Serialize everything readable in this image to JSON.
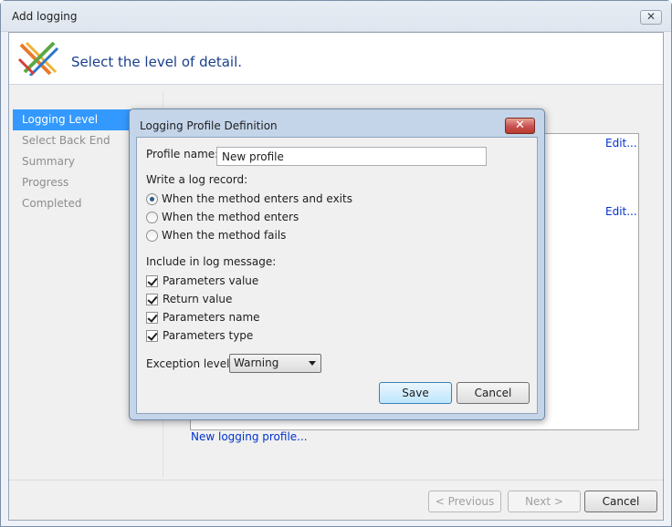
{
  "window": {
    "title": "Add logging"
  },
  "header": {
    "title": "Select the level of detail."
  },
  "nav": {
    "items": [
      {
        "label": "Logging Level",
        "active": true
      },
      {
        "label": "Select Back End",
        "active": false
      },
      {
        "label": "Summary",
        "active": false
      },
      {
        "label": "Progress",
        "active": false
      },
      {
        "label": "Completed",
        "active": false
      }
    ]
  },
  "panel": {
    "edit_links": [
      "Edit...",
      "Edit..."
    ],
    "new_profile_link": "New logging profile..."
  },
  "footer": {
    "previous_label": "< Previous",
    "next_label": "Next >",
    "cancel_label": "Cancel"
  },
  "dialog": {
    "title": "Logging Profile Definition",
    "close_glyph": "✕",
    "profile_name_label": "Profile name:",
    "profile_name_value": "New profile",
    "write_label": "Write a log record:",
    "write_options": [
      {
        "label": "When the method enters and exits",
        "checked": true
      },
      {
        "label": "When the method enters",
        "checked": false
      },
      {
        "label": "When the method fails",
        "checked": false
      }
    ],
    "include_label": "Include in log message:",
    "include_options": [
      {
        "label": "Parameters value",
        "checked": true
      },
      {
        "label": "Return value",
        "checked": true
      },
      {
        "label": "Parameters name",
        "checked": true
      },
      {
        "label": "Parameters type",
        "checked": true
      }
    ],
    "exception_label": "Exception level:",
    "exception_value": "Warning",
    "save_label": "Save",
    "cancel_label": "Cancel"
  },
  "colors": {
    "accent": "#3399ff",
    "link": "#0033cc",
    "header_title": "#1a3f8c",
    "dialog_close": "#c75050"
  }
}
